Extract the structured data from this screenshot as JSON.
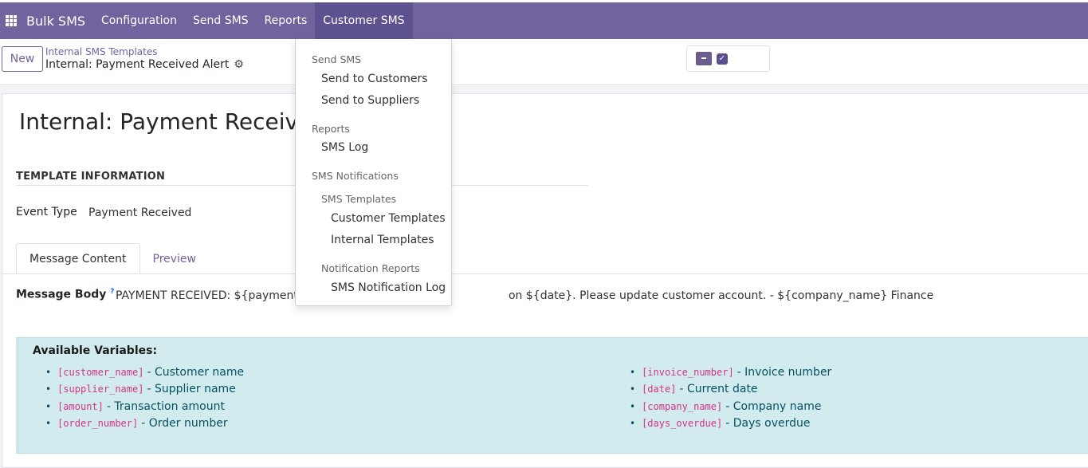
{
  "app": {
    "name": "Bulk SMS",
    "menu": [
      "Configuration",
      "Send SMS",
      "Reports",
      "Customer SMS"
    ]
  },
  "control_panel": {
    "new_label": "New",
    "breadcrumb_parent": "Internal SMS Templates",
    "breadcrumb_current": "Internal: Payment Received Alert"
  },
  "record": {
    "title": "Internal: Payment Received",
    "section_title": "TEMPLATE INFORMATION",
    "event_type_label": "Event Type",
    "event_type_value": "Payment Received",
    "tabs": [
      "Message Content",
      "Preview"
    ],
    "message_body_label": "Message Body",
    "message_body_help": "?",
    "message_body_value": "PAYMENT RECEIVED: ${payment_am",
    "message_body_value_tail": "on ${date}. Please update customer account. - ${company_name} Finance"
  },
  "variables": {
    "title": "Available Variables:",
    "left": [
      {
        "code": "[customer_name]",
        "desc": "- Customer name"
      },
      {
        "code": "[supplier_name]",
        "desc": "- Supplier name"
      },
      {
        "code": "[amount]",
        "desc": "- Transaction amount"
      },
      {
        "code": "[order_number]",
        "desc": "- Order number"
      }
    ],
    "right": [
      {
        "code": "[invoice_number]",
        "desc": "- Invoice number"
      },
      {
        "code": "[date]",
        "desc": "- Current date"
      },
      {
        "code": "[company_name]",
        "desc": "- Company name"
      },
      {
        "code": "[days_overdue]",
        "desc": "- Days overdue"
      }
    ]
  },
  "dropdown": {
    "send_sms_header": "Send SMS",
    "send_to_customers": "Send to Customers",
    "send_to_suppliers": "Send to Suppliers",
    "reports_header": "Reports",
    "sms_log": "SMS Log",
    "sms_notifications_header": "SMS Notifications",
    "sms_templates_header": "SMS Templates",
    "customer_templates": "Customer Templates",
    "internal_templates": "Internal Templates",
    "notification_reports_header": "Notification Reports",
    "sms_notification_log": "SMS Notification Log"
  }
}
